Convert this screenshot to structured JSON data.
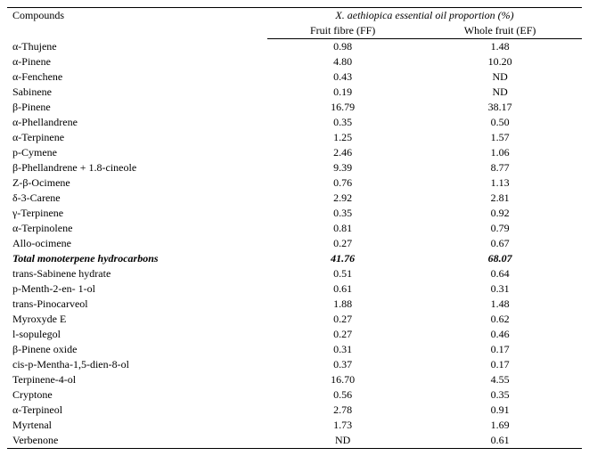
{
  "table": {
    "col1_header": "Compounds",
    "group_header": "X. aethiopica essential oil proportion (%)",
    "col2_header": "Fruit fibre (FF)",
    "col3_header": "Whole fruit (EF)",
    "rows": [
      {
        "compound": "α-Thujene",
        "ff": "0.98",
        "ef": "1.48",
        "style": "normal"
      },
      {
        "compound": "α-Pinene",
        "ff": "4.80",
        "ef": "10.20",
        "style": "normal"
      },
      {
        "compound": "α-Fenchene",
        "ff": "0.43",
        "ef": "ND",
        "style": "normal"
      },
      {
        "compound": "Sabinene",
        "ff": "0.19",
        "ef": "ND",
        "style": "normal"
      },
      {
        "compound": "β-Pinene",
        "ff": "16.79",
        "ef": "38.17",
        "style": "normal"
      },
      {
        "compound": "α-Phellandrene",
        "ff": "0.35",
        "ef": "0.50",
        "style": "normal"
      },
      {
        "compound": "α-Terpinene",
        "ff": "1.25",
        "ef": "1.57",
        "style": "normal"
      },
      {
        "compound": "p-Cymene",
        "ff": "2.46",
        "ef": "1.06",
        "style": "normal"
      },
      {
        "compound": "β-Phellandrene + 1.8-cineole",
        "ff": "9.39",
        "ef": "8.77",
        "style": "normal"
      },
      {
        "compound": "Z-β-Ocimene",
        "ff": "0.76",
        "ef": "1.13",
        "style": "normal"
      },
      {
        "compound": "δ-3-Carene",
        "ff": "2.92",
        "ef": "2.81",
        "style": "normal"
      },
      {
        "compound": "γ-Terpinene",
        "ff": "0.35",
        "ef": "0.92",
        "style": "normal"
      },
      {
        "compound": "α-Terpinolene",
        "ff": "0.81",
        "ef": "0.79",
        "style": "normal"
      },
      {
        "compound": "Allo-ocimene",
        "ff": "0.27",
        "ef": "0.67",
        "style": "normal"
      },
      {
        "compound": "Total monoterpene hydrocarbons",
        "ff": "41.76",
        "ef": "68.07",
        "style": "bold-italic"
      },
      {
        "compound": "trans-Sabinene hydrate",
        "ff": "0.51",
        "ef": "0.64",
        "style": "normal"
      },
      {
        "compound": "p-Menth-2-en- 1-ol",
        "ff": "0.61",
        "ef": "0.31",
        "style": "normal"
      },
      {
        "compound": "trans-Pinocarveol",
        "ff": "1.88",
        "ef": "1.48",
        "style": "normal"
      },
      {
        "compound": "Myroxyde E",
        "ff": "0.27",
        "ef": "0.62",
        "style": "normal"
      },
      {
        "compound": "l-sopulegol",
        "ff": "0.27",
        "ef": "0.46",
        "style": "normal"
      },
      {
        "compound": "β-Pinene oxide",
        "ff": "0.31",
        "ef": "0.17",
        "style": "normal"
      },
      {
        "compound": "cis-p-Mentha-1,5-dien-8-ol",
        "ff": "0.37",
        "ef": "0.17",
        "style": "normal"
      },
      {
        "compound": "Terpinene-4-ol",
        "ff": "16.70",
        "ef": "4.55",
        "style": "normal"
      },
      {
        "compound": "Cryptone",
        "ff": "0.56",
        "ef": "0.35",
        "style": "normal"
      },
      {
        "compound": "α-Terpineol",
        "ff": "2.78",
        "ef": "0.91",
        "style": "normal"
      },
      {
        "compound": "Myrtenal",
        "ff": "1.73",
        "ef": "1.69",
        "style": "normal"
      },
      {
        "compound": "Verbenone",
        "ff": "ND",
        "ef": "0.61",
        "style": "normal"
      }
    ]
  }
}
